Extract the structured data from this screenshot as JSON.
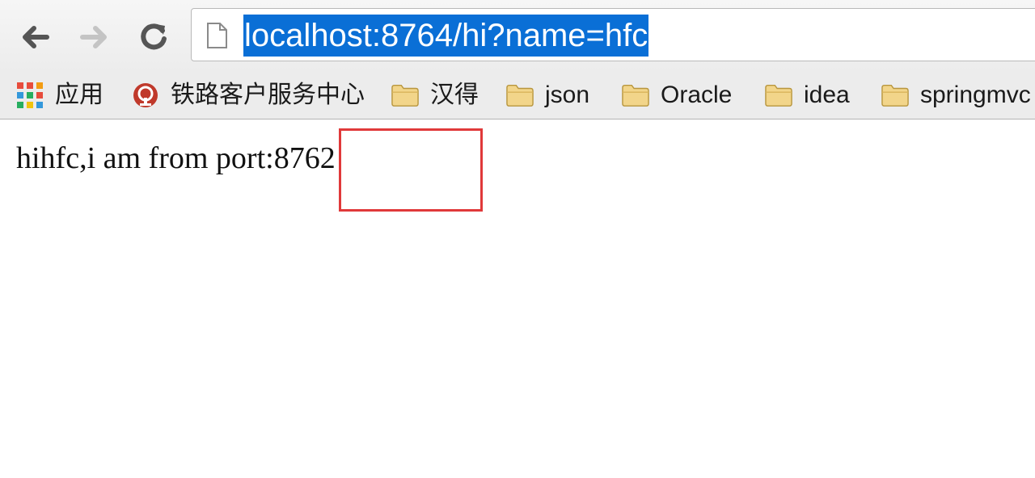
{
  "browser": {
    "address_bar": {
      "url": "localhost:8764/hi?name=hfc",
      "selected": true
    },
    "nav": {
      "back": "back-arrow-icon",
      "forward": "forward-arrow-icon",
      "reload": "reload-icon"
    },
    "bookmarks": [
      {
        "label": "应用",
        "icon": "apps-grid-icon"
      },
      {
        "label": "铁路客户服务中心",
        "icon": "railway-logo-icon"
      },
      {
        "label": "汉得",
        "icon": "folder-icon"
      },
      {
        "label": "json",
        "icon": "folder-icon"
      },
      {
        "label": "Oracle",
        "icon": "folder-icon"
      },
      {
        "label": "idea",
        "icon": "folder-icon"
      },
      {
        "label": "springmvc",
        "icon": "folder-icon"
      }
    ]
  },
  "page": {
    "body_text": "hihfc,i am from port:8762",
    "annotation": {
      "type": "red-rectangle",
      "color": "#e0393a"
    }
  },
  "colors": {
    "selection": "#0a6fd6",
    "annotation": "#e0393a",
    "toolbar": "#ececec"
  }
}
